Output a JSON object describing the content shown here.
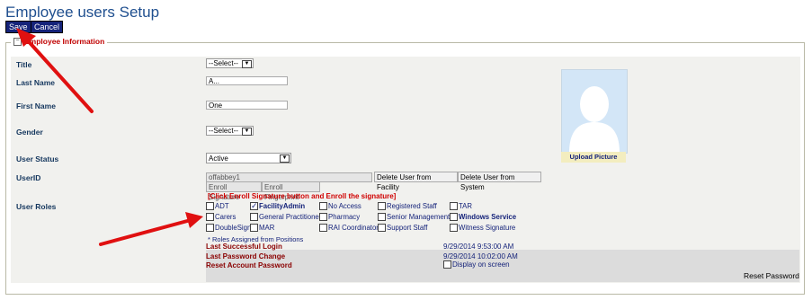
{
  "page": {
    "title": "Employee users Setup"
  },
  "toolbar": {
    "save_label": "Save",
    "cancel_label": "Cancel"
  },
  "section": {
    "legend": "Employee Information",
    "collapse_symbol": "−"
  },
  "form": {
    "title": {
      "label": "Title",
      "value": "--Select--"
    },
    "last_name": {
      "label": "Last Name",
      "value": "A..."
    },
    "first_name": {
      "label": "First Name",
      "value": "One"
    },
    "gender": {
      "label": "Gender",
      "value": "--Select--"
    },
    "user_status": {
      "label": "User Status",
      "value": "Active"
    },
    "userid": {
      "label": "UserID",
      "value": "offabbey1"
    },
    "user_roles": {
      "label": "User Roles"
    }
  },
  "buttons": {
    "delete_facility": "Delete User from Facility",
    "delete_system": "Delete User from System",
    "enroll_signature": "Enroll Signature",
    "enroll_fingerprint": "Enroll Fingerprint"
  },
  "enroll_notice": "[Click Enroll Signature button and Enroll the signature]",
  "roles": [
    {
      "label": "ADT",
      "checked": false
    },
    {
      "label": "FacilityAdmin",
      "checked": true
    },
    {
      "label": "No Access",
      "checked": false
    },
    {
      "label": "Registered Staff",
      "checked": false
    },
    {
      "label": "TAR",
      "checked": false
    },
    {
      "label": "Carers",
      "checked": false
    },
    {
      "label": "General Practitioner",
      "checked": false
    },
    {
      "label": "Pharmacy",
      "checked": false
    },
    {
      "label": "Senior Management",
      "checked": false
    },
    {
      "label": "Windows Service",
      "checked": false
    },
    {
      "label": "DoubleSign",
      "checked": false
    },
    {
      "label": "MAR",
      "checked": false
    },
    {
      "label": "RAI Coordinator",
      "checked": false
    },
    {
      "label": "Support Staff",
      "checked": false
    },
    {
      "label": "Witness Signature",
      "checked": false
    }
  ],
  "roles_note": "* Roles Assigned from Positions",
  "photo": {
    "upload_label": "Upload Picture"
  },
  "info": {
    "last_login_label": "Last Successful Login",
    "last_login_value": "9/29/2014 9:53:00 AM",
    "last_pw_label": "Last Password Change",
    "last_pw_value": "9/29/2014 10:02:00 AM",
    "reset_label": "Reset Account Password",
    "display_label": "Display on screen",
    "reset_button": "Reset Password"
  },
  "colors": {
    "accent": "#15237a",
    "alert": "#d00000",
    "annotation_arrow": "#e01010"
  }
}
